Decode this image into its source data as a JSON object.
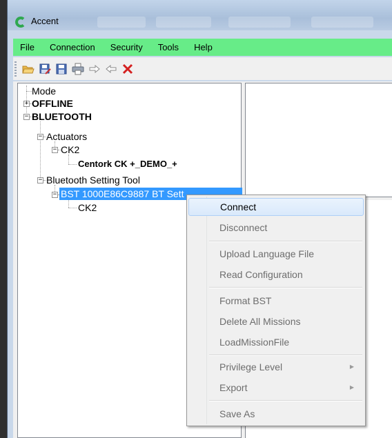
{
  "window": {
    "title": "Accent",
    "logo_color": "#2fa84f"
  },
  "menubar": {
    "bg_color": "#67ec88",
    "items": [
      "File",
      "Connection",
      "Security",
      "Tools",
      "Help"
    ]
  },
  "toolbar": {
    "icons": [
      "open-folder-icon",
      "save-as-icon",
      "save-icon",
      "print-icon",
      "arrow-right-icon",
      "arrow-left-icon",
      "delete-x-icon"
    ]
  },
  "tree": {
    "mode": "Mode",
    "offline": "OFFLINE",
    "bluetooth": "BLUETOOTH",
    "actuators": "Actuators",
    "actuator_ck2": "CK2",
    "centork": "Centork CK +_DEMO_+",
    "bst_tool": "Bluetooth Setting Tool",
    "bst_device": "BST 1000E86C9887 BT Sett",
    "bst_ck2": "CK2"
  },
  "context_menu": {
    "connect": "Connect",
    "disconnect": "Disconnect",
    "upload_language": "Upload Language File",
    "read_configuration": "Read Configuration",
    "format_bst": "Format BST",
    "delete_missions": "Delete All Missions",
    "load_mission": "LoadMissionFile",
    "privilege_level": "Privilege Level",
    "export": "Export",
    "save_as": "Save As"
  }
}
